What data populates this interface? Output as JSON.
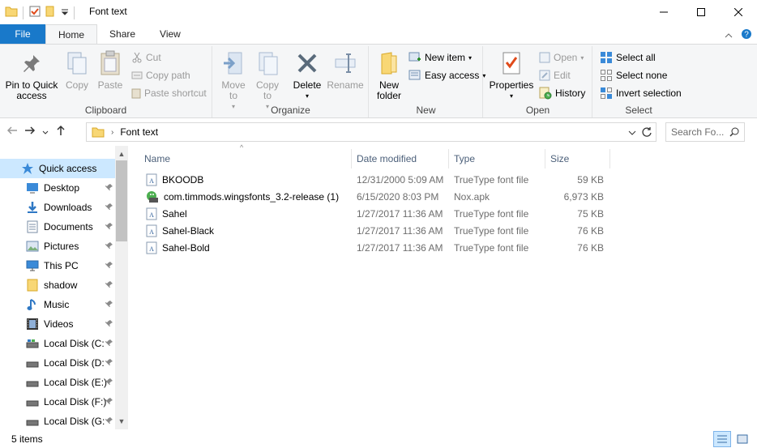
{
  "window": {
    "title": "Font text",
    "controls": {
      "minimize": "minimize",
      "maximize": "maximize",
      "close": "close"
    }
  },
  "ribbon_tabs": {
    "file": "File",
    "home": "Home",
    "share": "Share",
    "view": "View"
  },
  "ribbon": {
    "clipboard": {
      "label": "Clipboard",
      "pin": "Pin to Quick access",
      "copy": "Copy",
      "paste": "Paste",
      "cut": "Cut",
      "copy_path": "Copy path",
      "paste_shortcut": "Paste shortcut"
    },
    "organize": {
      "label": "Organize",
      "move_to": "Move to",
      "copy_to": "Copy to",
      "delete": "Delete",
      "rename": "Rename"
    },
    "new": {
      "label": "New",
      "new_folder": "New folder",
      "new_item": "New item",
      "easy_access": "Easy access"
    },
    "open": {
      "label": "Open",
      "properties": "Properties",
      "open": "Open",
      "edit": "Edit",
      "history": "History"
    },
    "select": {
      "label": "Select",
      "select_all": "Select all",
      "select_none": "Select none",
      "invert_selection": "Invert selection"
    }
  },
  "address": {
    "path": "Font text",
    "search_placeholder": "Search Fo..."
  },
  "nav_pane": {
    "items": [
      {
        "label": "Quick access",
        "icon": "star-icon"
      },
      {
        "label": "Desktop",
        "icon": "desktop-icon"
      },
      {
        "label": "Downloads",
        "icon": "download-icon"
      },
      {
        "label": "Documents",
        "icon": "documents-icon"
      },
      {
        "label": "Pictures",
        "icon": "pictures-icon"
      },
      {
        "label": "This PC",
        "icon": "computer-icon"
      },
      {
        "label": "shadow",
        "icon": "folder-icon"
      },
      {
        "label": "Music",
        "icon": "music-icon"
      },
      {
        "label": "Videos",
        "icon": "videos-icon"
      },
      {
        "label": "Local Disk (C:",
        "icon": "disk-icon"
      },
      {
        "label": "Local Disk (D:",
        "icon": "disk-icon"
      },
      {
        "label": "Local Disk (E:)",
        "icon": "disk-icon"
      },
      {
        "label": "Local Disk (F:)",
        "icon": "disk-icon"
      },
      {
        "label": "Local Disk (G:",
        "icon": "disk-icon"
      }
    ]
  },
  "columns": {
    "name": "Name",
    "date": "Date modified",
    "type": "Type",
    "size": "Size"
  },
  "files": [
    {
      "name": "BKOODB",
      "date": "12/31/2000 5:09 AM",
      "type": "TrueType font file",
      "size": "59 KB",
      "icon": "font-file-icon"
    },
    {
      "name": "com.timmods.wingsfonts_3.2-release (1)",
      "date": "6/15/2020 8:03 PM",
      "type": "Nox.apk",
      "size": "6,973 KB",
      "icon": "apk-file-icon"
    },
    {
      "name": "Sahel",
      "date": "1/27/2017 11:36 AM",
      "type": "TrueType font file",
      "size": "75 KB",
      "icon": "font-file-icon"
    },
    {
      "name": "Sahel-Black",
      "date": "1/27/2017 11:36 AM",
      "type": "TrueType font file",
      "size": "76 KB",
      "icon": "font-file-icon"
    },
    {
      "name": "Sahel-Bold",
      "date": "1/27/2017 11:36 AM",
      "type": "TrueType font file",
      "size": "76 KB",
      "icon": "font-file-icon"
    }
  ],
  "status": {
    "count": "5 items"
  },
  "colors": {
    "accent": "#1979ca",
    "selection": "#cce8ff",
    "ribbon_bg": "#f5f6f7"
  }
}
